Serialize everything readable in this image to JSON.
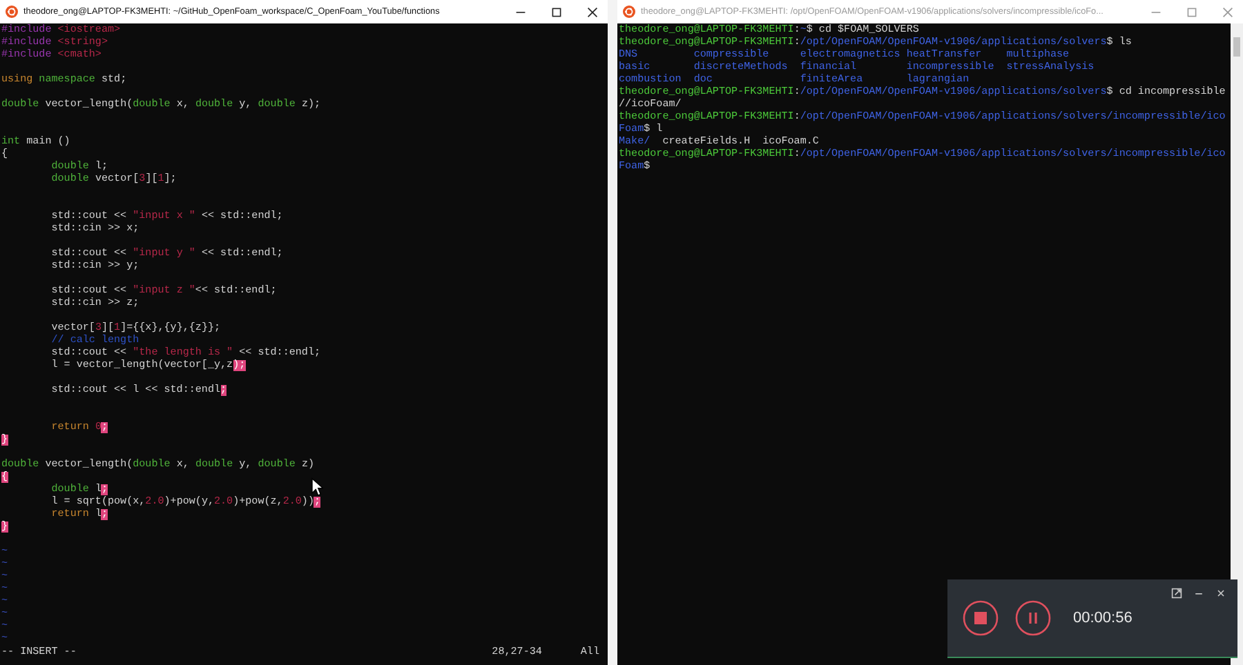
{
  "windows": [
    {
      "title": "theodore_ong@LAPTOP-FK3MEHTI: ~/GitHub_OpenFoam_workspace/C_OpenFoam_YouTube/functions",
      "focused": true,
      "kind": "editor",
      "lines": [
        {
          "kind": "code",
          "segments": [
            {
              "text": "#include",
              "kind": "preproc"
            },
            {
              "text": " <iostream>",
              "kind": "string"
            }
          ]
        },
        {
          "kind": "code",
          "segments": [
            {
              "text": "#include",
              "kind": "preproc"
            },
            {
              "text": " <string>",
              "kind": "string"
            }
          ]
        },
        {
          "kind": "code",
          "segments": [
            {
              "text": "#include",
              "kind": "preproc"
            },
            {
              "text": " <cmath>",
              "kind": "string"
            }
          ]
        },
        {
          "kind": "blank"
        },
        {
          "kind": "code",
          "segments": [
            {
              "text": "using",
              "kind": "keyword"
            },
            {
              "text": " namespace",
              "kind": "type"
            },
            {
              "text": " std;",
              "kind": "plain"
            }
          ]
        },
        {
          "kind": "blank"
        },
        {
          "kind": "code",
          "segments": [
            {
              "text": "double",
              "kind": "type"
            },
            {
              "text": " vector_length(",
              "kind": "plain"
            },
            {
              "text": "double",
              "kind": "type"
            },
            {
              "text": " x, ",
              "kind": "plain"
            },
            {
              "text": "double",
              "kind": "type"
            },
            {
              "text": " y, ",
              "kind": "plain"
            },
            {
              "text": "double",
              "kind": "type"
            },
            {
              "text": " z);",
              "kind": "plain"
            }
          ]
        },
        {
          "kind": "blank"
        },
        {
          "kind": "blank"
        },
        {
          "kind": "code",
          "segments": [
            {
              "text": "int",
              "kind": "type"
            },
            {
              "text": " main ()",
              "kind": "plain"
            }
          ]
        },
        {
          "kind": "code",
          "segments": [
            {
              "text": "{",
              "kind": "plain"
            }
          ]
        },
        {
          "kind": "code",
          "segments": [
            {
              "text": "\tdouble",
              "kind": "type"
            },
            {
              "text": " l;",
              "kind": "plain"
            }
          ]
        },
        {
          "kind": "code",
          "segments": [
            {
              "text": "\tdouble",
              "kind": "type"
            },
            {
              "text": " vector[",
              "kind": "plain"
            },
            {
              "text": "3",
              "kind": "number"
            },
            {
              "text": "][",
              "kind": "plain"
            },
            {
              "text": "1",
              "kind": "number"
            },
            {
              "text": "];",
              "kind": "plain"
            }
          ]
        },
        {
          "kind": "blank"
        },
        {
          "kind": "blank"
        },
        {
          "kind": "code",
          "segments": [
            {
              "text": "\tstd::cout << ",
              "kind": "plain"
            },
            {
              "text": "\"input x \"",
              "kind": "string"
            },
            {
              "text": " << std::endl;",
              "kind": "plain"
            }
          ]
        },
        {
          "kind": "code",
          "segments": [
            {
              "text": "\tstd::cin >> x;",
              "kind": "plain"
            }
          ]
        },
        {
          "kind": "blank"
        },
        {
          "kind": "code",
          "segments": [
            {
              "text": "\tstd::cout << ",
              "kind": "plain"
            },
            {
              "text": "\"input y \"",
              "kind": "string"
            },
            {
              "text": " << std::endl;",
              "kind": "plain"
            }
          ]
        },
        {
          "kind": "code",
          "segments": [
            {
              "text": "\tstd::cin >> y;",
              "kind": "plain"
            }
          ]
        },
        {
          "kind": "blank"
        },
        {
          "kind": "code",
          "segments": [
            {
              "text": "\tstd::cout << ",
              "kind": "plain"
            },
            {
              "text": "\"input z \"",
              "kind": "string"
            },
            {
              "text": "<< std::endl;",
              "kind": "plain"
            }
          ]
        },
        {
          "kind": "code",
          "segments": [
            {
              "text": "\tstd::cin >> z;",
              "kind": "plain"
            }
          ]
        },
        {
          "kind": "blank"
        },
        {
          "kind": "code",
          "segments": [
            {
              "text": "\tvector[",
              "kind": "plain"
            },
            {
              "text": "3",
              "kind": "number"
            },
            {
              "text": "][",
              "kind": "plain"
            },
            {
              "text": "1",
              "kind": "number"
            },
            {
              "text": "]={{x},{y},{z}};",
              "kind": "plain"
            }
          ]
        },
        {
          "kind": "code",
          "segments": [
            {
              "text": "\t// calc length",
              "kind": "comment"
            }
          ]
        },
        {
          "kind": "code",
          "segments": [
            {
              "text": "\tstd::cout << ",
              "kind": "plain"
            },
            {
              "text": "\"the length is \"",
              "kind": "string"
            },
            {
              "text": " << std::endl;",
              "kind": "plain"
            }
          ]
        },
        {
          "kind": "code",
          "segments": [
            {
              "text": "\tl = vector_length(vector[_y,z",
              "kind": "plain"
            },
            {
              "text": ");",
              "kind": "error"
            }
          ]
        },
        {
          "kind": "blank"
        },
        {
          "kind": "code",
          "segments": [
            {
              "text": "\tstd::cout << l << std::endl",
              "kind": "plain"
            },
            {
              "text": ";",
              "kind": "error"
            }
          ]
        },
        {
          "kind": "blank"
        },
        {
          "kind": "blank"
        },
        {
          "kind": "code",
          "segments": [
            {
              "text": "\treturn",
              "kind": "keyword"
            },
            {
              "text": " 0",
              "kind": "number"
            },
            {
              "text": ";",
              "kind": "error"
            }
          ]
        },
        {
          "kind": "code",
          "segments": [
            {
              "text": "}",
              "kind": "error"
            }
          ]
        },
        {
          "kind": "blank"
        },
        {
          "kind": "code",
          "segments": [
            {
              "text": "double",
              "kind": "type"
            },
            {
              "text": " vector_length(",
              "kind": "plain"
            },
            {
              "text": "double",
              "kind": "type"
            },
            {
              "text": " x, ",
              "kind": "plain"
            },
            {
              "text": "double",
              "kind": "type"
            },
            {
              "text": " y, ",
              "kind": "plain"
            },
            {
              "text": "double",
              "kind": "type"
            },
            {
              "text": " z)",
              "kind": "plain"
            }
          ]
        },
        {
          "kind": "code",
          "segments": [
            {
              "text": "{",
              "kind": "error"
            }
          ]
        },
        {
          "kind": "code",
          "segments": [
            {
              "text": "\tdouble",
              "kind": "type"
            },
            {
              "text": " l",
              "kind": "plain"
            },
            {
              "text": ";",
              "kind": "error"
            }
          ]
        },
        {
          "kind": "code",
          "segments": [
            {
              "text": "\tl = sqrt(pow(x,",
              "kind": "plain"
            },
            {
              "text": "2.0",
              "kind": "number"
            },
            {
              "text": ")+pow(y,",
              "kind": "plain"
            },
            {
              "text": "2.0",
              "kind": "number"
            },
            {
              "text": ")+pow(z,",
              "kind": "plain"
            },
            {
              "text": "2.0",
              "kind": "number"
            },
            {
              "text": "))",
              "kind": "plain"
            },
            {
              "text": ";",
              "kind": "error"
            }
          ]
        },
        {
          "kind": "code",
          "segments": [
            {
              "text": "\treturn",
              "kind": "keyword"
            },
            {
              "text": " l",
              "kind": "plain"
            },
            {
              "text": ";",
              "kind": "error"
            }
          ]
        },
        {
          "kind": "code",
          "segments": [
            {
              "text": "}",
              "kind": "error"
            }
          ]
        },
        {
          "kind": "blank"
        },
        {
          "kind": "tilde",
          "text": "~"
        },
        {
          "kind": "tilde",
          "text": "~"
        },
        {
          "kind": "tilde",
          "text": "~"
        },
        {
          "kind": "tilde",
          "text": "~"
        },
        {
          "kind": "tilde",
          "text": "~"
        },
        {
          "kind": "tilde",
          "text": "~"
        },
        {
          "kind": "tilde",
          "text": "~"
        },
        {
          "kind": "tilde",
          "text": "~"
        }
      ],
      "status": {
        "mode": "-- INSERT --",
        "position": "28,27-34",
        "scroll": "All"
      }
    },
    {
      "title": "theodore_ong@LAPTOP-FK3MEHTI: /opt/OpenFOAM/OpenFOAM-v1906/applications/solvers/incompressible/icoFo...",
      "focused": false,
      "kind": "terminal",
      "lines": [
        {
          "kind": "text",
          "segments": [
            {
              "text": "theodore_ong@LAPTOP-FK3MEHTI",
              "kind": "user"
            },
            {
              "text": ":",
              "kind": "plain"
            },
            {
              "text": "~",
              "kind": "path"
            },
            {
              "text": "$ cd $FOAM_SOLVERS",
              "kind": "plain"
            }
          ]
        },
        {
          "kind": "text",
          "segments": [
            {
              "text": "theodore_ong@LAPTOP-FK3MEHTI",
              "kind": "user"
            },
            {
              "text": ":",
              "kind": "plain"
            },
            {
              "text": "/opt/OpenFOAM/OpenFOAM-v1906/applications/solvers",
              "kind": "path"
            },
            {
              "text": "$ ls",
              "kind": "plain"
            }
          ]
        },
        {
          "kind": "grid",
          "cells": [
            {
              "text": "DNS",
              "kind": "dir"
            },
            {
              "text": "compressible",
              "kind": "dir"
            },
            {
              "text": "electromagnetics",
              "kind": "dir"
            },
            {
              "text": "heatTransfer",
              "kind": "dir"
            },
            {
              "text": "multiphase",
              "kind": "dir"
            }
          ]
        },
        {
          "kind": "grid",
          "cells": [
            {
              "text": "basic",
              "kind": "dir"
            },
            {
              "text": "discreteMethods",
              "kind": "dir"
            },
            {
              "text": "financial",
              "kind": "dir"
            },
            {
              "text": "incompressible",
              "kind": "dir"
            },
            {
              "text": "stressAnalysis",
              "kind": "dir"
            }
          ]
        },
        {
          "kind": "grid",
          "cells": [
            {
              "text": "combustion",
              "kind": "dir"
            },
            {
              "text": "doc",
              "kind": "dir"
            },
            {
              "text": "finiteArea",
              "kind": "dir"
            },
            {
              "text": "lagrangian",
              "kind": "dir"
            }
          ]
        },
        {
          "kind": "text",
          "segments": [
            {
              "text": "theodore_ong@LAPTOP-FK3MEHTI",
              "kind": "user"
            },
            {
              "text": ":",
              "kind": "plain"
            },
            {
              "text": "/opt/OpenFOAM/OpenFOAM-v1906/applications/solvers",
              "kind": "path"
            },
            {
              "text": "$ cd incompressible",
              "kind": "plain"
            }
          ]
        },
        {
          "kind": "text",
          "segments": [
            {
              "text": "//icoFoam/",
              "kind": "plain"
            }
          ]
        },
        {
          "kind": "text",
          "segments": [
            {
              "text": "theodore_ong@LAPTOP-FK3MEHTI",
              "kind": "user"
            },
            {
              "text": ":",
              "kind": "plain"
            },
            {
              "text": "/opt/OpenFOAM/OpenFOAM-v1906/applications/solvers/incompressible/ico",
              "kind": "path"
            }
          ]
        },
        {
          "kind": "text",
          "segments": [
            {
              "text": "Foam",
              "kind": "path"
            },
            {
              "text": "$ l",
              "kind": "plain"
            }
          ]
        },
        {
          "kind": "list",
          "cells": [
            {
              "text": "Make/",
              "kind": "dir"
            },
            {
              "text": "createFields.H",
              "kind": "plain"
            },
            {
              "text": "icoFoam.C",
              "kind": "plain"
            }
          ]
        },
        {
          "kind": "text",
          "segments": [
            {
              "text": "theodore_ong@LAPTOP-FK3MEHTI",
              "kind": "user"
            },
            {
              "text": ":",
              "kind": "plain"
            },
            {
              "text": "/opt/OpenFOAM/OpenFOAM-v1906/applications/solvers/incompressible/ico",
              "kind": "path"
            }
          ]
        },
        {
          "kind": "text",
          "segments": [
            {
              "text": "Foam",
              "kind": "path"
            },
            {
              "text": "$",
              "kind": "plain"
            }
          ]
        }
      ]
    }
  ],
  "recorder": {
    "time": "00:00:56"
  }
}
